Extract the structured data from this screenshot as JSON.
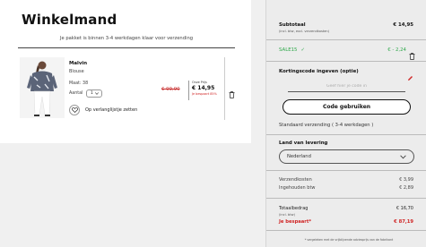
{
  "cart": {
    "title": "Winkelmand",
    "delivery_note": "Je pakket is binnen 3-4 werkdagen klaar voor verzending"
  },
  "item": {
    "name": "Malvin",
    "type": "Blouse",
    "size_label": "Maat:",
    "size_value": "38",
    "qty_label": "Aantal",
    "qty_value": "1",
    "old_price": "€ 99,90",
    "price_label": "Onze Prijs",
    "price": "€ 14,95",
    "saved": "Je bespaart 85%",
    "wishlist_label": "Op verlanglijstje zetten"
  },
  "summary": {
    "subtotal_label": "Subtotaal",
    "subtotal_note": "(incl. btw, excl. verzendkosten)",
    "subtotal_value": "€ 14,95",
    "sale_label": "SALE15",
    "sale_check": "✓",
    "sale_value": "€ - 2,24",
    "discount_title": "Kortingscode ingeven (optie)",
    "discount_placeholder": "Geef hier je code in",
    "discount_button": "Code gebruiken",
    "standard_shipping": "Standaard verzending ( 3-4 werkdagen )",
    "country_title": "Land van levering",
    "country_value": "Nederland",
    "shipping_label": "Verzendkosten",
    "shipping_value": "€ 3,99",
    "vat_label": "Ingehouden btw",
    "vat_value": "€ 2,89",
    "total_label": "Totaalbedrag",
    "total_note": "(incl. btw)",
    "total_value": "€ 16,70",
    "saved_label": "Je bespaart*",
    "saved_value": "€ 87,19",
    "footnote": "* vergeleken met de vrijblijvende adviesprijs van de fabrikant"
  },
  "colors": {
    "accent_red": "#d02525",
    "sale_green": "#2ea84a",
    "panel_gray": "#ececec"
  }
}
